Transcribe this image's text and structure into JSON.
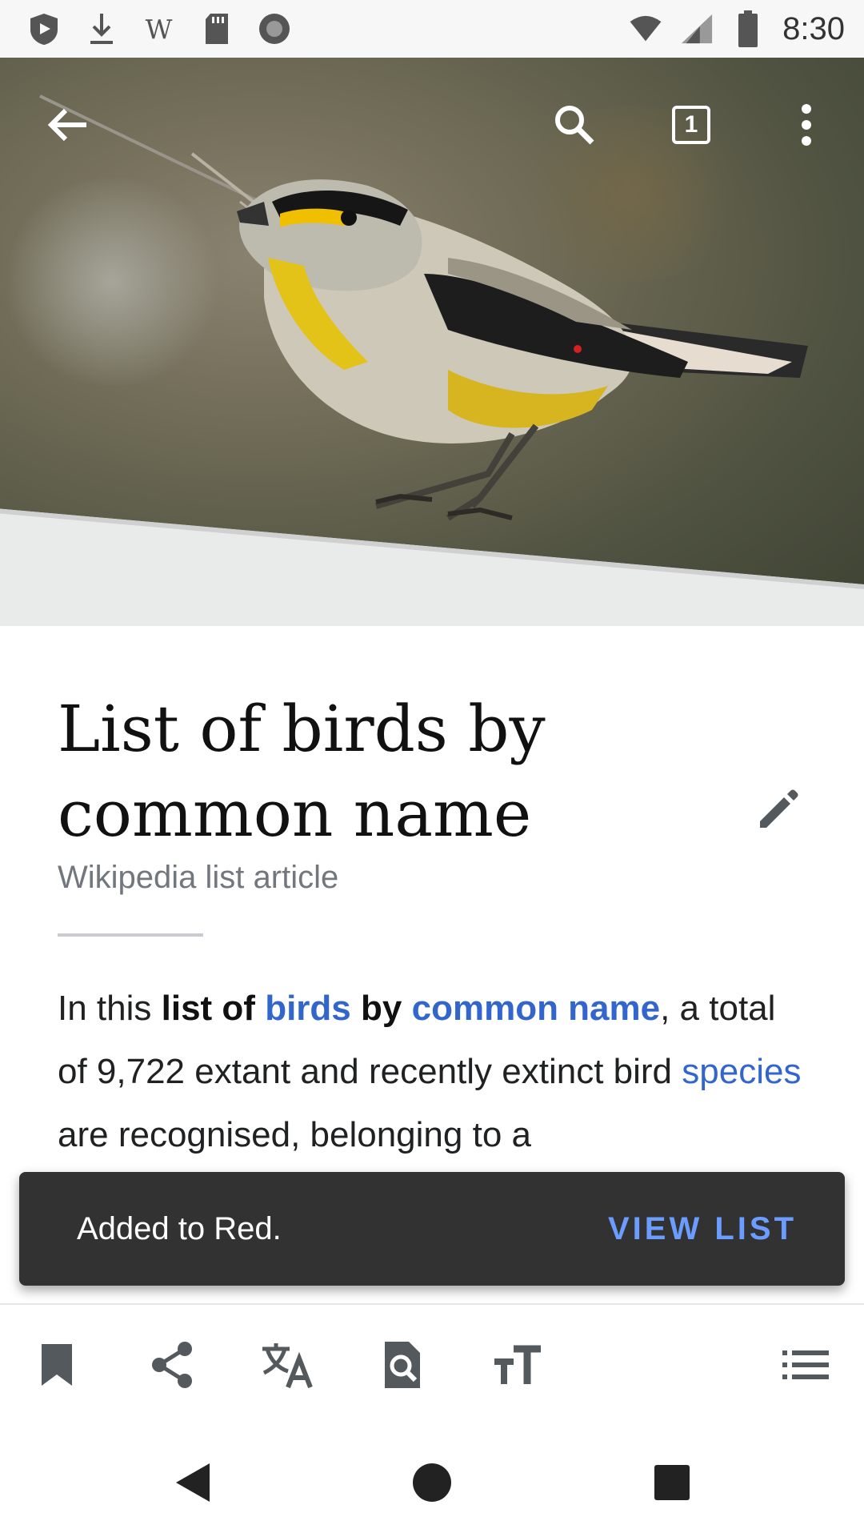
{
  "status_bar": {
    "time": "8:30",
    "left_icons": [
      "shield-play-icon",
      "download-icon",
      "wikipedia-icon",
      "sd-card-icon",
      "record-icon"
    ],
    "right_icons": [
      "wifi-icon",
      "signal-icon",
      "battery-icon"
    ]
  },
  "toolbar": {
    "tab_count": "1",
    "icons": [
      "back-arrow-icon",
      "search-icon",
      "tabs-icon",
      "more-vert-icon"
    ]
  },
  "article": {
    "title": "List of birds by common name",
    "description": "Wikipedia list article",
    "lead": {
      "t1": "In this ",
      "bold1": "list of",
      "link1": "birds",
      "bold2": "by",
      "link2": "common name",
      "t2": ", a total of 9,722 extant and recently extinct bird ",
      "link3": "species",
      "t3": " are recognised, belonging to a"
    }
  },
  "snackbar": {
    "message": "Added to Red.",
    "action": "VIEW LIST"
  },
  "bottom_bar": {
    "icons": [
      "bookmark-icon",
      "share-icon",
      "translate-icon",
      "find-in-page-icon",
      "text-size-icon",
      "table-of-contents-icon"
    ]
  },
  "nav_bar": {
    "icons": [
      "nav-back-icon",
      "nav-home-icon",
      "nav-recents-icon"
    ]
  },
  "colors": {
    "link": "#3366cc",
    "snackbar_bg": "#323232",
    "snackbar_action": "#6b9cff",
    "description": "#72777d"
  }
}
